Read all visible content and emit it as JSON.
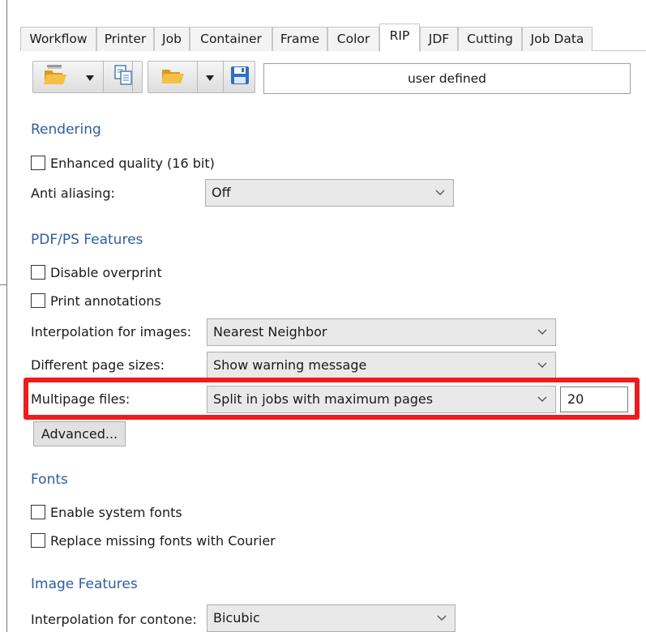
{
  "tabs": [
    "Workflow",
    "Printer",
    "Job",
    "Container",
    "Frame",
    "Color",
    "RIP",
    "JDF",
    "Cutting",
    "Job Data"
  ],
  "active_tab": "RIP",
  "toolbar": {
    "icons": [
      "open-folder-icon",
      "dropdown-arrow-icon",
      "copy-icon",
      "open-folder-icon",
      "dropdown-arrow-icon",
      "save-icon"
    ],
    "preset_name": "user defined"
  },
  "rendering": {
    "title": "Rendering",
    "enhanced_quality": {
      "label": "Enhanced quality (16 bit)",
      "checked": false
    },
    "anti_aliasing": {
      "label": "Anti aliasing:",
      "value": "Off"
    }
  },
  "pdf_ps": {
    "title": "PDF/PS Features",
    "disable_overprint": {
      "label": "Disable overprint",
      "checked": false
    },
    "print_annotations": {
      "label": "Print annotations",
      "checked": false
    },
    "interpolation_images": {
      "label": "Interpolation for images:",
      "value": "Nearest Neighbor"
    },
    "different_page_sizes": {
      "label": "Different page sizes:",
      "value": "Show warning message"
    },
    "multipage_files": {
      "label": "Multipage files:",
      "value": "Split in jobs with maximum pages",
      "max_pages": "20"
    },
    "advanced_label": "Advanced..."
  },
  "fonts": {
    "title": "Fonts",
    "enable_system_fonts": {
      "label": "Enable system fonts",
      "checked": false
    },
    "replace_missing": {
      "label": "Replace missing fonts with Courier",
      "checked": false
    }
  },
  "image_features": {
    "title": "Image Features",
    "interpolation_contone": {
      "label": "Interpolation for contone:",
      "value": "Bicubic"
    }
  },
  "colors": {
    "section_title": "#2f5e9e",
    "highlight": "#ee1c1c"
  }
}
